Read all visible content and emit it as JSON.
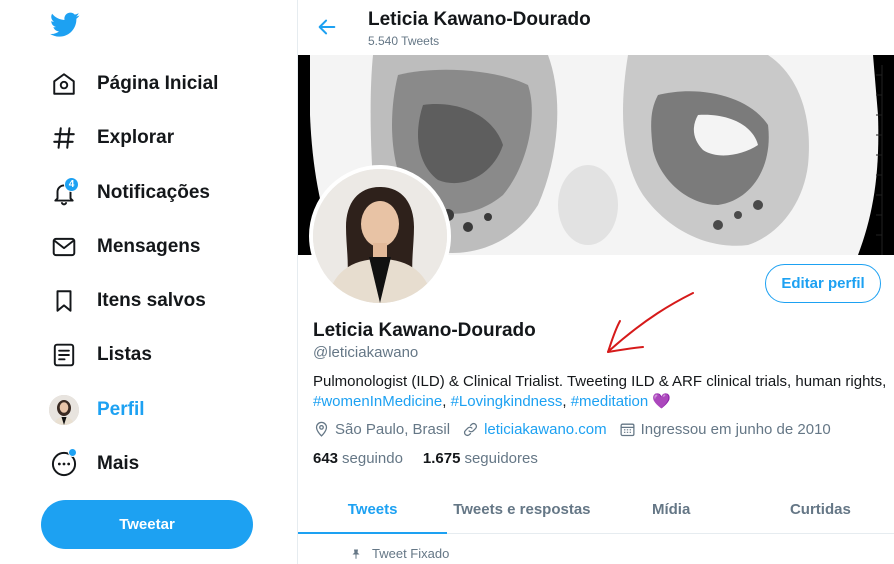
{
  "colors": {
    "accent": "#1da1f2",
    "text": "#14171a",
    "muted": "#657786",
    "annotation": "#d61a1a"
  },
  "sidebar": {
    "logo_icon": "twitter-bird-icon",
    "items": [
      {
        "label": "Página Inicial",
        "icon": "home-icon"
      },
      {
        "label": "Explorar",
        "icon": "hashtag-icon"
      },
      {
        "label": "Notificações",
        "icon": "bell-icon",
        "badge": "4"
      },
      {
        "label": "Mensagens",
        "icon": "envelope-icon"
      },
      {
        "label": "Itens salvos",
        "icon": "bookmark-icon"
      },
      {
        "label": "Listas",
        "icon": "list-icon"
      },
      {
        "label": "Perfil",
        "icon": "avatar-icon",
        "active": true
      },
      {
        "label": "Mais",
        "icon": "more-icon"
      }
    ],
    "tweet_button": "Tweetar"
  },
  "header": {
    "title": "Leticia Kawano-Dourado",
    "subtitle": "5.540 Tweets"
  },
  "profile": {
    "edit_button": "Editar perfil",
    "name": "Leticia Kawano-Dourado",
    "handle": "@leticiakawano",
    "bio_text": "Pulmonologist (ILD) & Clinical Trialist. Tweeting ILD & ARF clinical trials, human rights,",
    "bio_tags": [
      "#womenInMedicine",
      "#Lovingkindness",
      "#meditation"
    ],
    "bio_emoji": "💜",
    "location": "São Paulo, Brasil",
    "website": "leticiakawano.com",
    "joined": "Ingressou em junho de 2010",
    "following_count": "643",
    "following_label": "seguindo",
    "followers_count": "1.675",
    "followers_label": "seguidores"
  },
  "tabs": [
    {
      "label": "Tweets",
      "active": true
    },
    {
      "label": "Tweets e respostas"
    },
    {
      "label": "Mídia"
    },
    {
      "label": "Curtidas"
    }
  ],
  "pinned_label": "Tweet Fixado"
}
